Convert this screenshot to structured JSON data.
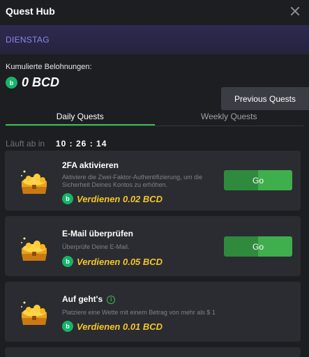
{
  "header": {
    "title": "Quest Hub"
  },
  "banner": {
    "day": "DIENSTAG"
  },
  "rewards": {
    "label": "Kumulierte Belohnungen:",
    "value": "0 BCD",
    "coin_letter": "b"
  },
  "previous_button": "Previous Quests",
  "tabs": [
    {
      "label": "Daily Quests"
    },
    {
      "label": "Weekly Quests"
    }
  ],
  "timer": {
    "label": "Läuft ab in",
    "time": "10 : 26 : 14"
  },
  "quests": [
    {
      "title": "2FA aktivieren",
      "description": "Aktiviere die Zwei-Faktor-Authentifizierung, um die Sicherheit Deines Kontos zu erhöhen.",
      "earn": "Verdienen 0.02 BCD",
      "button": "Go"
    },
    {
      "title": "E-Mail überprüfen",
      "description": "Überprüfe Deine E-Mail.",
      "earn": "Verdienen 0.05 BCD",
      "button": "Go"
    },
    {
      "title": "Auf geht's",
      "info": "i",
      "description": "Platziere eine Wette mit einem Betrag von mehr als $ 1",
      "earn": "Verdienen 0.01 BCD"
    }
  ],
  "colors": {
    "accent_green": "#3fbb52",
    "gold": "#f7c52b",
    "banner_purple": "#8d86f0"
  }
}
